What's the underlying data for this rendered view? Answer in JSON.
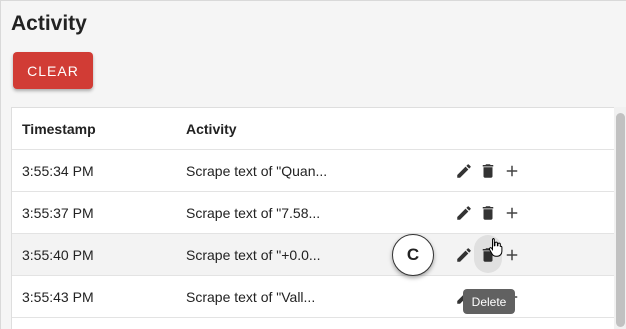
{
  "panel": {
    "title": "Activity",
    "clear_label": "CLEAR"
  },
  "table": {
    "columns": [
      "Timestamp",
      "Activity"
    ],
    "rows": [
      {
        "timestamp": "3:55:34 PM",
        "activity": "Scrape text of \"Quan..."
      },
      {
        "timestamp": "3:55:37 PM",
        "activity": "Scrape text of \"7.58..."
      },
      {
        "timestamp": "3:55:40 PM",
        "activity": "Scrape text of \"+0.0..."
      },
      {
        "timestamp": "3:55:43 PM",
        "activity": "Scrape text of \"Vall..."
      }
    ],
    "row_icons": [
      "pencil-icon",
      "trash-icon",
      "plus-icon"
    ]
  },
  "overlay": {
    "marker_label": "C",
    "tooltip": "Delete"
  },
  "colors": {
    "accent": "#d13c35",
    "tooltip_bg": "#616161",
    "icon": "#333333"
  }
}
